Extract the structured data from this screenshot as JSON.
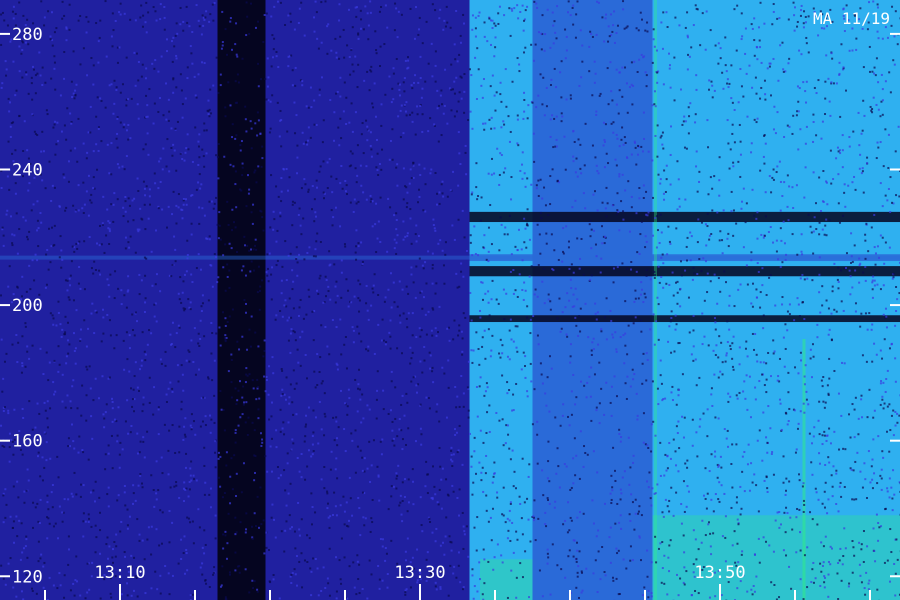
{
  "chart_data": {
    "type": "heatmap",
    "title": "",
    "corner_label": "MA 11/19",
    "xlabel": "",
    "ylabel": "",
    "y_ticks": [
      "280",
      "240",
      "200",
      "160",
      "120"
    ],
    "y_tick_values": [
      280,
      240,
      200,
      160,
      120
    ],
    "ylim": [
      113,
      290
    ],
    "x_ticks": [
      "13:10",
      "13:30",
      "13:50"
    ],
    "x_tick_values": [
      10,
      30,
      50
    ],
    "xlim": [
      2,
      62
    ],
    "minor_tick_minutes": [
      5,
      15,
      20,
      25,
      35,
      40,
      45,
      55,
      60
    ],
    "colors": {
      "background": "#15157a",
      "quiet": "#2020a0",
      "gap": "#050520",
      "active": "#2a6ad8",
      "bright": "#2fb0f0",
      "peak": "#30f080",
      "labels": "#ffffff"
    },
    "time_segments": [
      {
        "start": 2,
        "end": 16.5,
        "level": "quiet"
      },
      {
        "start": 16.5,
        "end": 19.7,
        "level": "gap"
      },
      {
        "start": 19.7,
        "end": 33.3,
        "level": "quiet"
      },
      {
        "start": 33.3,
        "end": 37.5,
        "level": "bright"
      },
      {
        "start": 37.5,
        "end": 42.5,
        "level": "active"
      },
      {
        "start": 42.5,
        "end": 45.5,
        "level": "active"
      },
      {
        "start": 45.5,
        "end": 62,
        "level": "bright"
      }
    ],
    "freq_bands": [
      {
        "center": 214,
        "width": 2,
        "note": "horizontal line"
      },
      {
        "center": 226,
        "width": 3,
        "note": "dark band"
      },
      {
        "center": 210,
        "width": 3,
        "note": "dark band"
      },
      {
        "center": 196,
        "width": 2,
        "note": "dark band"
      }
    ]
  }
}
